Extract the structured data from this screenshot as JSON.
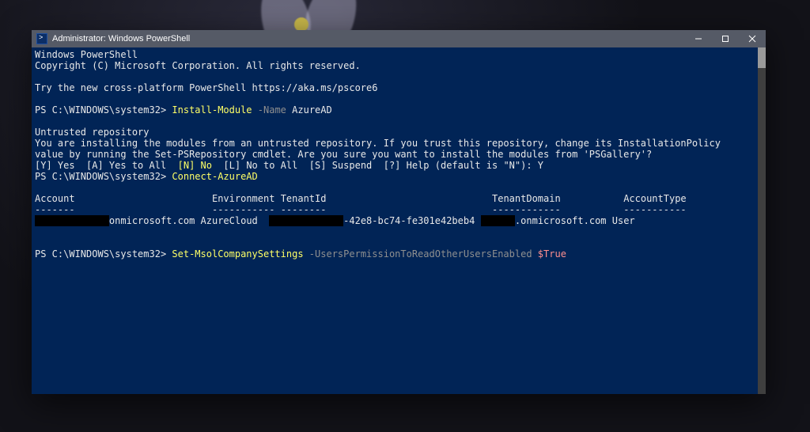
{
  "window": {
    "title": "Administrator: Windows PowerShell"
  },
  "banner": {
    "line1": "Windows PowerShell",
    "line2": "Copyright (C) Microsoft Corporation. All rights reserved.",
    "try": "Try the new cross-platform PowerShell https://aka.ms/pscore6"
  },
  "prompt": "PS C:\\WINDOWS\\system32> ",
  "cmd1": {
    "cmdlet": "Install-Module",
    "param": "-Name",
    "arg": "AzureAD"
  },
  "untrusted": {
    "header": "Untrusted repository",
    "body1": "You are installing the modules from an untrusted repository. If you trust this repository, change its InstallationPolicy",
    "body2": "value by running the Set-PSRepository cmdlet. Are you sure you want to install the modules from 'PSGallery'?",
    "opt_yes": "[Y] Yes  [A] Yes to All  ",
    "opt_no": "[N] No",
    "opt_rest": "  [L] No to All  [S] Suspend  [?] Help (default is \"N\"): ",
    "answer": "Y"
  },
  "cmd2": {
    "cmdlet": "Connect-AzureAD"
  },
  "table": {
    "h_account": "Account",
    "h_env": "Environment",
    "h_tenantid": "TenantId",
    "h_tenantdomain": "TenantDomain",
    "h_accttype": "AccountType",
    "sep_account": "-------",
    "sep_env": "-----------",
    "sep_tenantid": "--------",
    "sep_tenantdomain": "------------",
    "sep_accttype": "-----------",
    "row": {
      "account_suffix": "onmicrosoft.com",
      "env": "AzureCloud",
      "tenantid_suffix": "-42e8-bc74-fe301e42beb4",
      "tenantdomain_suffix": ".onmicrosoft.com",
      "accttype": "User"
    }
  },
  "cmd3": {
    "cmdlet": "Set-MsolCompanySettings",
    "param": "-UsersPermissionToReadOtherUsersEnabled",
    "val": "$True"
  }
}
